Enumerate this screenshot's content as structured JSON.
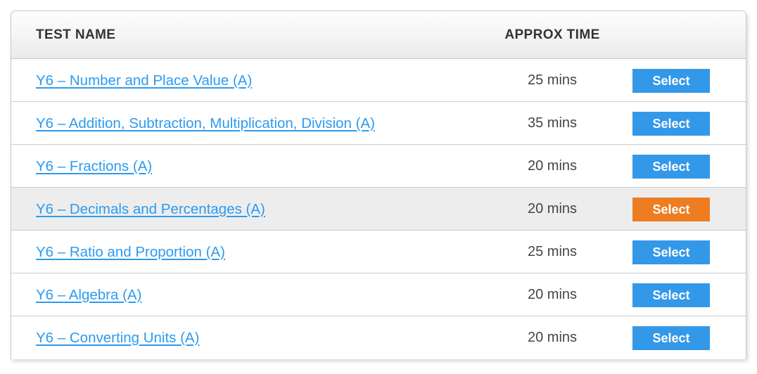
{
  "table": {
    "columns": {
      "name_header": "TEST NAME",
      "time_header": "APPROX TIME"
    },
    "colors": {
      "link": "#2c9bf0",
      "button_default": "#3498e8",
      "button_hover": "#ee7d22",
      "row_highlight": "#ededed",
      "border": "#cccccc",
      "header_text": "#333333",
      "time_text": "#454545"
    },
    "rows": [
      {
        "name": "Y6 – Number and Place Value (A)",
        "time": "25 mins",
        "action_label": "Select",
        "highlighted": false
      },
      {
        "name": "Y6 – Addition, Subtraction, Multiplication, Division (A)",
        "time": "35 mins",
        "action_label": "Select",
        "highlighted": false
      },
      {
        "name": "Y6 – Fractions (A)",
        "time": "20 mins",
        "action_label": "Select",
        "highlighted": false
      },
      {
        "name": "Y6 – Decimals and Percentages (A)",
        "time": "20 mins",
        "action_label": "Select",
        "highlighted": true
      },
      {
        "name": "Y6 – Ratio and Proportion (A)",
        "time": "25 mins",
        "action_label": "Select",
        "highlighted": false
      },
      {
        "name": "Y6 – Algebra (A)",
        "time": "20 mins",
        "action_label": "Select",
        "highlighted": false
      },
      {
        "name": "Y6 – Converting Units (A)",
        "time": "20 mins",
        "action_label": "Select",
        "highlighted": false
      }
    ]
  }
}
